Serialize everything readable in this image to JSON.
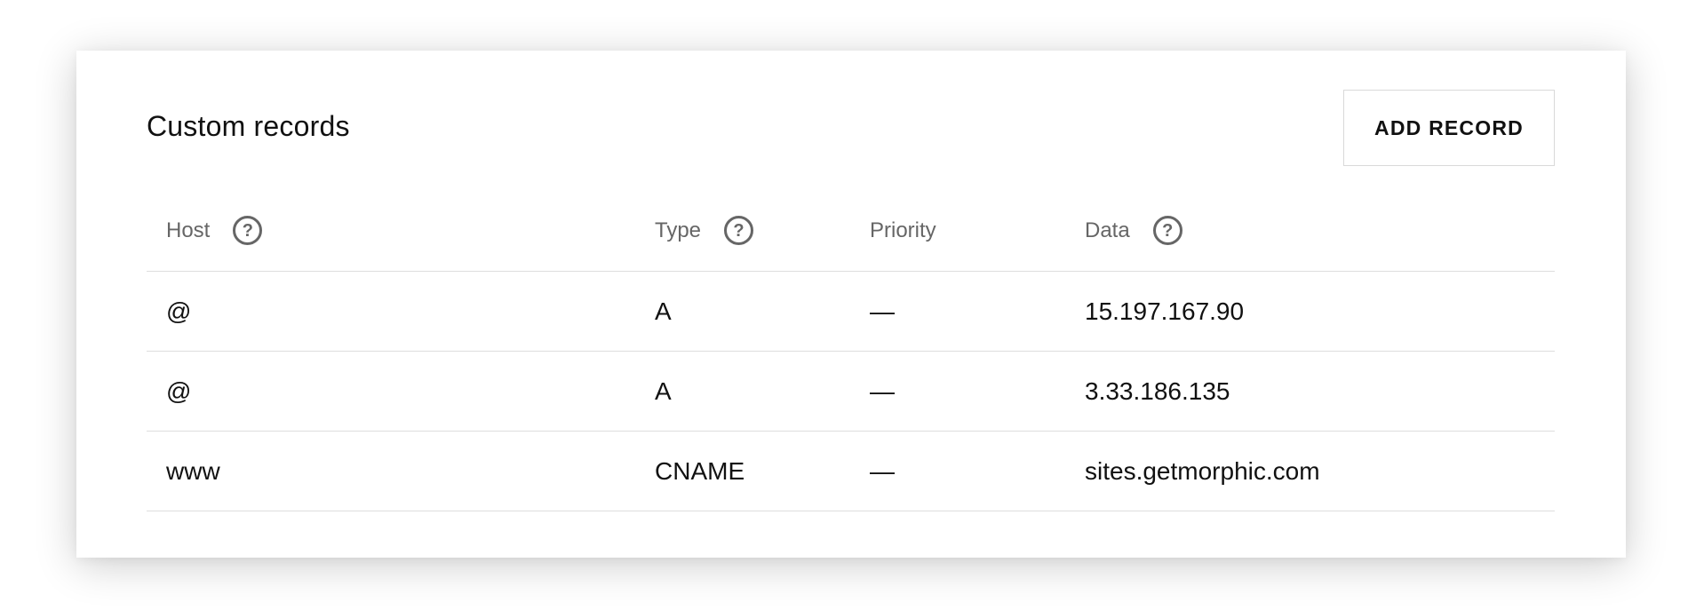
{
  "custom_records": {
    "title": "Custom records",
    "add_button_label": "ADD RECORD",
    "columns": {
      "host": "Host",
      "type": "Type",
      "priority": "Priority",
      "data": "Data"
    },
    "help_glyph": "?",
    "rows": [
      {
        "host": "@",
        "type": "A",
        "priority": "—",
        "data": "15.197.167.90"
      },
      {
        "host": "@",
        "type": "A",
        "priority": "—",
        "data": "3.33.186.135"
      },
      {
        "host": "www",
        "type": "CNAME",
        "priority": "—",
        "data": "sites.getmorphic.com"
      }
    ]
  },
  "colors": {
    "text": "#111111",
    "muted": "#666666",
    "divider": "#dedede",
    "button_border": "#d9d9d9"
  },
  "icons": {
    "help": "question-circle-icon"
  }
}
